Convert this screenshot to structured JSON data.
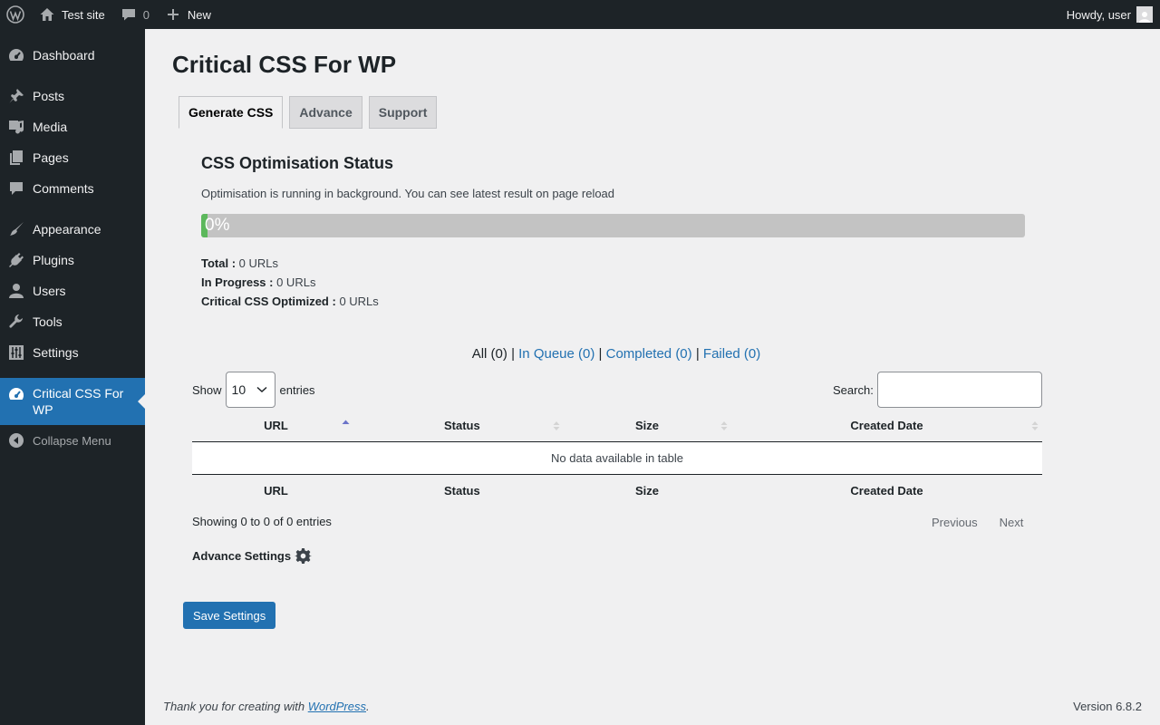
{
  "adminbar": {
    "site_name": "Test site",
    "comments_count": "0",
    "new_label": "New",
    "greeting": "Howdy, user"
  },
  "sidebar": {
    "items": [
      {
        "label": "Dashboard",
        "icon": "dashboard-icon"
      },
      {
        "label": "Posts",
        "icon": "pin-icon"
      },
      {
        "label": "Media",
        "icon": "media-icon"
      },
      {
        "label": "Pages",
        "icon": "pages-icon"
      },
      {
        "label": "Comments",
        "icon": "comment-icon"
      },
      {
        "label": "Appearance",
        "icon": "brush-icon"
      },
      {
        "label": "Plugins",
        "icon": "plug-icon"
      },
      {
        "label": "Users",
        "icon": "user-icon"
      },
      {
        "label": "Tools",
        "icon": "wrench-icon"
      },
      {
        "label": "Settings",
        "icon": "sliders-icon"
      },
      {
        "label": "Critical CSS For",
        "label2": "WP",
        "icon": "dashboard-icon"
      }
    ],
    "collapse_label": "Collapse Menu"
  },
  "page": {
    "title": "Critical CSS For WP",
    "tabs": [
      {
        "label": "Generate CSS",
        "active": true
      },
      {
        "label": "Advance",
        "active": false
      },
      {
        "label": "Support",
        "active": false
      }
    ]
  },
  "status": {
    "title": "CSS Optimisation Status",
    "message": "Optimisation is running in background. You can see latest result on page reload",
    "progress_label": "0%",
    "progress_value": 0,
    "progress_color": "#5cb85c",
    "total_label": "Total :",
    "total_value": "0 URLs",
    "in_progress_label": "In Progress :",
    "in_progress_value": "0 URLs",
    "optimized_label": "Critical CSS Optimized :",
    "optimized_value": "0 URLs"
  },
  "filters": {
    "all": "All (0)",
    "sep": "|",
    "in_queue": "In Queue (0)",
    "completed": "Completed (0)",
    "failed": "Failed (0)"
  },
  "table": {
    "show_label": "Show",
    "entries_label": "entries",
    "page_size": "10",
    "search_label": "Search:",
    "search_value": "",
    "columns": [
      "URL",
      "Status",
      "Size",
      "Created Date"
    ],
    "empty_message": "No data available in table",
    "info": "Showing 0 to 0 of 0 entries",
    "previous": "Previous",
    "next": "Next"
  },
  "advance_settings_label": "Advance Settings",
  "save_button": "Save Settings",
  "footer": {
    "thanks_prefix": "Thank you for creating with",
    "wordpress_link": "WordPress",
    "thanks_suffix": ".",
    "version": "Version 6.8.2"
  },
  "colors": {
    "primary": "#2271b1",
    "sidebar_bg": "#1d2327",
    "page_bg": "#f0f0f1",
    "progress_track": "#c3c3c3"
  }
}
